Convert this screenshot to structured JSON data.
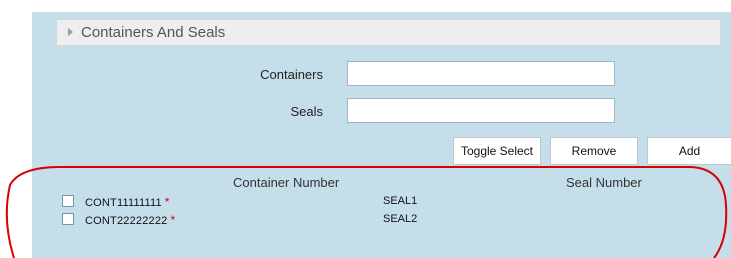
{
  "section": {
    "title": "Containers And Seals"
  },
  "form": {
    "containers_label": "Containers",
    "containers_value": "",
    "seals_label": "Seals",
    "seals_value": ""
  },
  "buttons": {
    "toggle_select": "Toggle Select",
    "remove": "Remove",
    "add": "Add"
  },
  "table": {
    "columns": [
      "Container Number",
      "Seal Number"
    ],
    "rows": [
      {
        "container": "CONT11111111",
        "required": "*",
        "seal": "SEAL1"
      },
      {
        "container": "CONT22222222",
        "required": "*",
        "seal": "SEAL2"
      }
    ]
  },
  "colors": {
    "panel_background": "#c5dfea",
    "highlight_outline": "#d80000",
    "required_marker": "#dd0000"
  },
  "icons": {
    "section_toggle": "triangle-right-icon"
  }
}
